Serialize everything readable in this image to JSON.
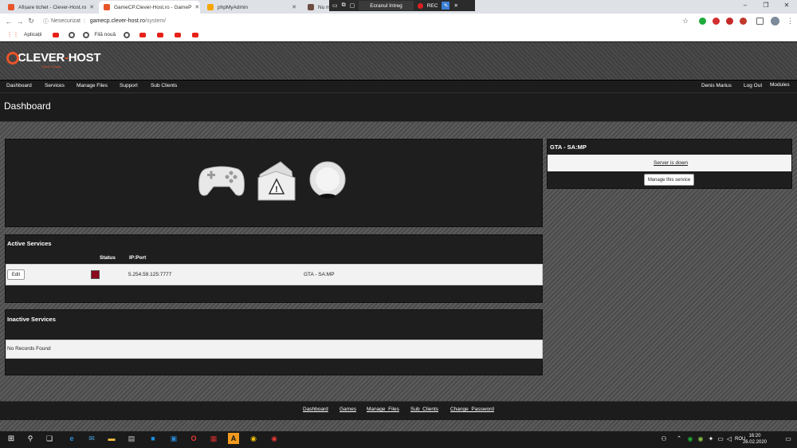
{
  "browser": {
    "tabs": [
      {
        "title": "Afișare tichet - Clever-Host.ro",
        "color": "#e8552a"
      },
      {
        "title": "GameCP.Clever-Host.ro - GameP",
        "color": "#e8552a"
      },
      {
        "title": "phpMyAdmin",
        "color": "#f7a600"
      },
      {
        "title": "Nu m",
        "color": "#6d4c41"
      }
    ],
    "recorder": {
      "screen_label": "Ecranul întreg",
      "rec_label": "REC"
    },
    "address": {
      "secure_label": "Nesecurizat",
      "host": "gamecp.clever-host.ro",
      "path": "/system/"
    },
    "bookmarks": {
      "apps_label": "Aplicații",
      "new_tab_label": "Filă nouă"
    }
  },
  "site": {
    "brand": {
      "clever": "CLEVER",
      "host": "HOST",
      "tagline": "Clever Cheap"
    },
    "nav": {
      "left": [
        "Dashboard",
        "Services",
        "Manage Files",
        "Support",
        "Sub Clients"
      ],
      "user": "Denis Marius",
      "logout": "Log Out",
      "modules": "Modules"
    },
    "page_title": "Dashboard",
    "server_panel": {
      "title": "GTA - SA:MP",
      "status_text": "Server is down",
      "manage_button": "Manage this service"
    },
    "active_services": {
      "title": "Active Services",
      "columns": [
        "Status",
        "IP:Port"
      ],
      "rows": [
        {
          "edit": "Edit",
          "status_color": "#8b0a1e",
          "ip": "5.254.59.125:7777",
          "name": "GTA - SA:MP"
        }
      ]
    },
    "inactive_services": {
      "title": "Inactive Services",
      "empty_text": "No Records Found"
    },
    "footer_links": [
      "Dashboard",
      "Games",
      "Manage_Files",
      "Sub_Clients",
      "Change_Password"
    ]
  },
  "taskbar": {
    "lang": "ROU",
    "time": "16:20",
    "date": "26.02.2020"
  }
}
